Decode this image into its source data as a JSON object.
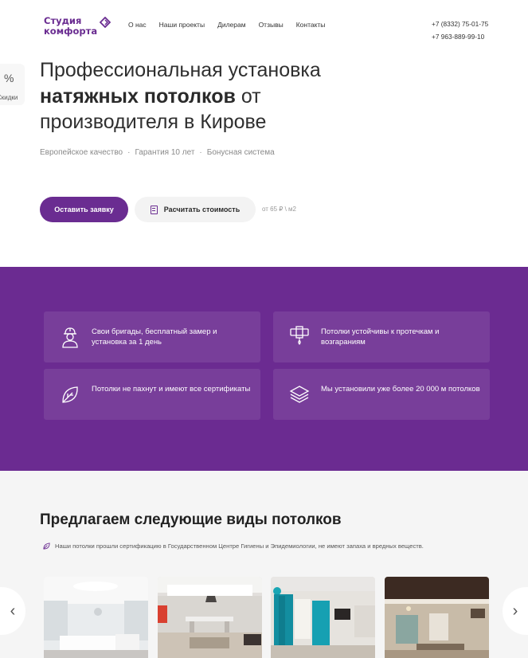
{
  "logo": {
    "line1": "Студия",
    "line2": "комфорта"
  },
  "nav": {
    "items": [
      "О нас",
      "Наши проекты",
      "Дилерам",
      "Отзывы",
      "Контакты"
    ]
  },
  "phones": [
    "+7 (8332) 75-01-75",
    "+7 963-889-99-10"
  ],
  "side_widget": {
    "symbol": "%",
    "label": "Скидки"
  },
  "hero": {
    "title_part1": "Профессиональная установка",
    "title_bold": "натяжных потолков",
    "title_part2": " от производителя в Кирове",
    "features": [
      "Европейское качество",
      "Гарантия 10 лет",
      "Бонусная система"
    ],
    "cta_primary": "Оставить заявку",
    "cta_secondary": "Расчитать стоимость",
    "price_note": "от 65 ₽ \\ м2"
  },
  "benefits": [
    {
      "icon": "worker-icon",
      "text": "Свои бригады, бесплатный замер и установка за 1 день"
    },
    {
      "icon": "leak-proof-ceiling-icon",
      "text": "Потолки устойчивы к протечкам и возгараниям"
    },
    {
      "icon": "leaf-icon",
      "text": "Потолки не пахнут и имеют все сертификаты"
    },
    {
      "icon": "layers-icon",
      "text": "Мы установили уже более 20 000 м потолков"
    }
  ],
  "catalog": {
    "title": "Предлагаем следующие виды потолков",
    "note": "Наши потолки прошли сертификацию в Государственном Центре Гигиены и Эпидемиологии, не имеют запаха и вредных веществ.",
    "photos": [
      "ceiling-photo-white-living-room",
      "ceiling-photo-dining-room",
      "ceiling-photo-blue-curtains",
      "ceiling-photo-brown-kitchen"
    ]
  },
  "colors": {
    "brand": "#6a2c91",
    "band": "#6b2b91"
  }
}
